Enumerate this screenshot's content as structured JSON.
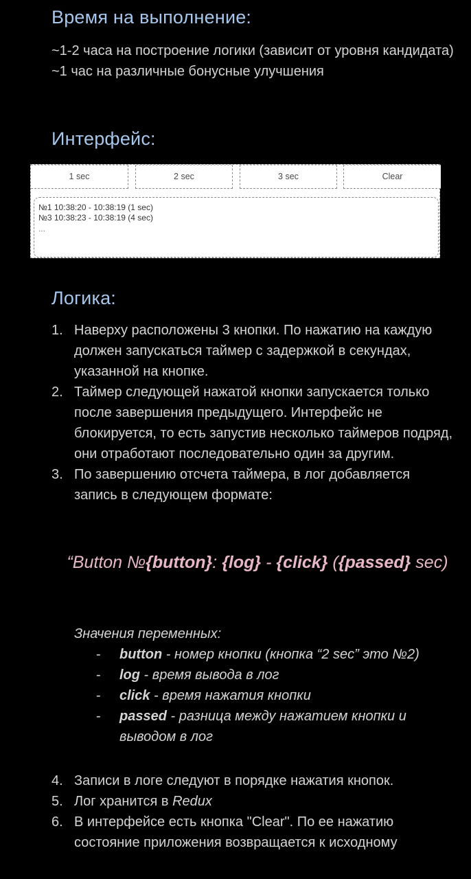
{
  "sections": {
    "time_title": "Время на выполнение:",
    "ui_title": "Интерфейс:",
    "logic_title": "Логика:"
  },
  "time_items": [
    "~1-2 часа на построение логики (зависит от уровня кандидата)",
    "~1 час на различные бонусные улучшения"
  ],
  "mockup": {
    "buttons": [
      "1 sec",
      "2 sec",
      "3 sec",
      "Clear"
    ],
    "log_lines": [
      "№1 10:38:20 - 10:38:19 (1 sec)",
      "№3 10:38:23 - 10:38:19 (4 sec)",
      "..."
    ]
  },
  "logic_items": [
    {
      "num": "1.",
      "text": "Наверху расположены 3 кнопки. По нажатию на каждую должен запускаться таймер с задержкой в секундах, указанной на кнопке."
    },
    {
      "num": "2.",
      "text": "Таймер следующей нажатой кнопки запускается только после завершения предыдущего. Интерфейс не блокируется, то есть запустив несколько таймеров подряд, они отработают последовательно один за другим."
    },
    {
      "num": "3.",
      "text": "По завершению отсчета таймера, в лог добавляется запись в следующем формате:"
    }
  ],
  "formula": {
    "p1": "“Button №",
    "button": "{button}",
    "p2": ": ",
    "log": "{log}",
    "p3": " - ",
    "click": "{click}",
    "p4": " (",
    "passed": "{passed}",
    "p5": " sec)"
  },
  "vars_title": "Значения переменных:",
  "vars": [
    {
      "name": "button",
      "desc": " - номер кнопки (кнопка “2 sec” это №2)"
    },
    {
      "name": "log",
      "desc": " - время вывода в лог"
    },
    {
      "name": "click",
      "desc": " - время нажатия кнопки"
    },
    {
      "name": "passed",
      "desc": " - разница между нажатием кнопки и выводом в лог"
    }
  ],
  "dash": "-",
  "logic_items_2": [
    {
      "num": "4.",
      "text": "Записи в логе следуют в порядке нажатия кнопок."
    },
    {
      "num": "5.",
      "text": "Лог хранится в ",
      "italic": "Redux"
    },
    {
      "num": "6.",
      "text": "В интерфейсе есть кнопка \"Clear\". По ее нажатию состояние приложения возвращается к исходному"
    }
  ]
}
